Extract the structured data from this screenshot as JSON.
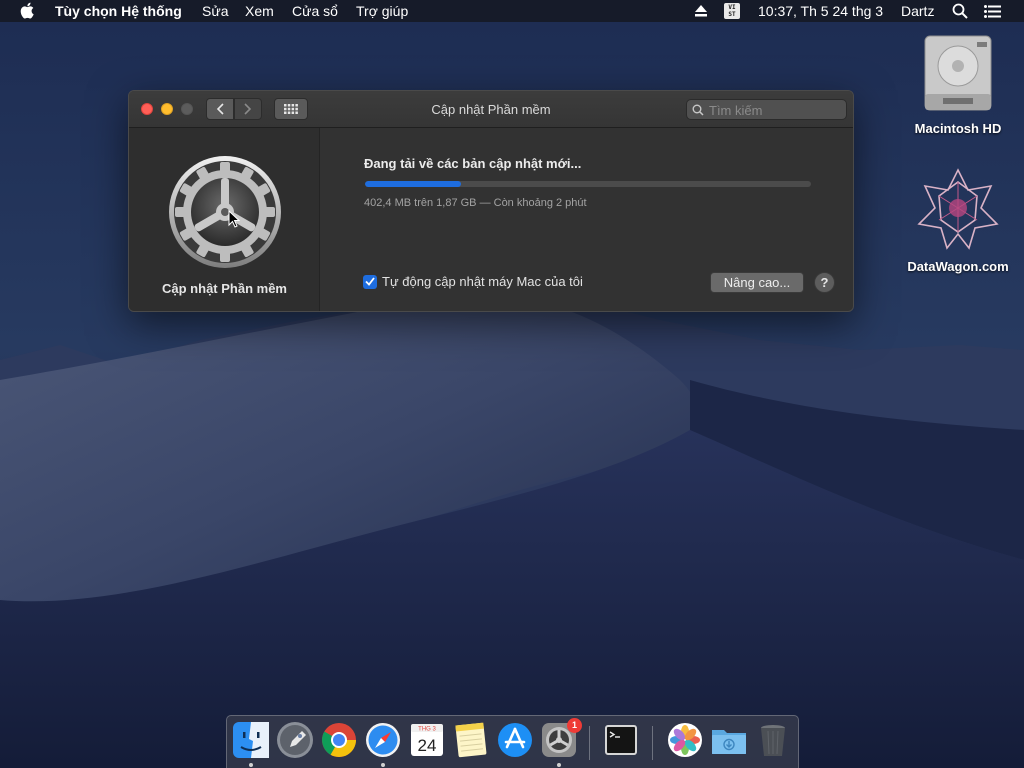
{
  "menubar": {
    "app_name": "Tùy chọn Hệ thống",
    "menus": [
      "Sửa",
      "Xem",
      "Cửa sổ",
      "Trợ giúp"
    ],
    "input_source": "VI ST",
    "clock": "10:37, Th 5 24 thg 3",
    "user": "Dartz"
  },
  "desktop": {
    "icons": [
      {
        "label": "Macintosh HD",
        "icon": "hard-drive-icon"
      },
      {
        "label": "DataWagon.com",
        "icon": "datawagon-logo-icon"
      }
    ]
  },
  "window": {
    "title": "Cập nhật Phần mềm",
    "search_placeholder": "Tìm kiếm",
    "sidebar_label": "Cập nhật Phần mềm",
    "status": "Đang tải về các bản cập nhật mới...",
    "progress": 0.215,
    "detail": "402,4 MB trên 1,87 GB — Còn khoảng 2 phút",
    "auto_update_label": "Tự động cập nhật máy Mac của tôi",
    "auto_update_checked": true,
    "advanced_button": "Nâng cao...",
    "help_button": "?"
  },
  "dock": {
    "calendar_month": "THG 3",
    "calendar_day": "24",
    "system_prefs_badge": "1",
    "items": [
      "finder-icon",
      "launchpad-icon",
      "chrome-icon",
      "safari-icon",
      "calendar-icon",
      "notes-icon",
      "app-store-icon",
      "system-preferences-icon",
      "terminal-icon",
      "photos-icon",
      "downloads-folder-icon",
      "trash-icon"
    ]
  },
  "colors": {
    "accent": "#1e6ddf",
    "close": "#ff5f57",
    "minimize": "#ffbd2e",
    "badge": "#ef3b36"
  }
}
